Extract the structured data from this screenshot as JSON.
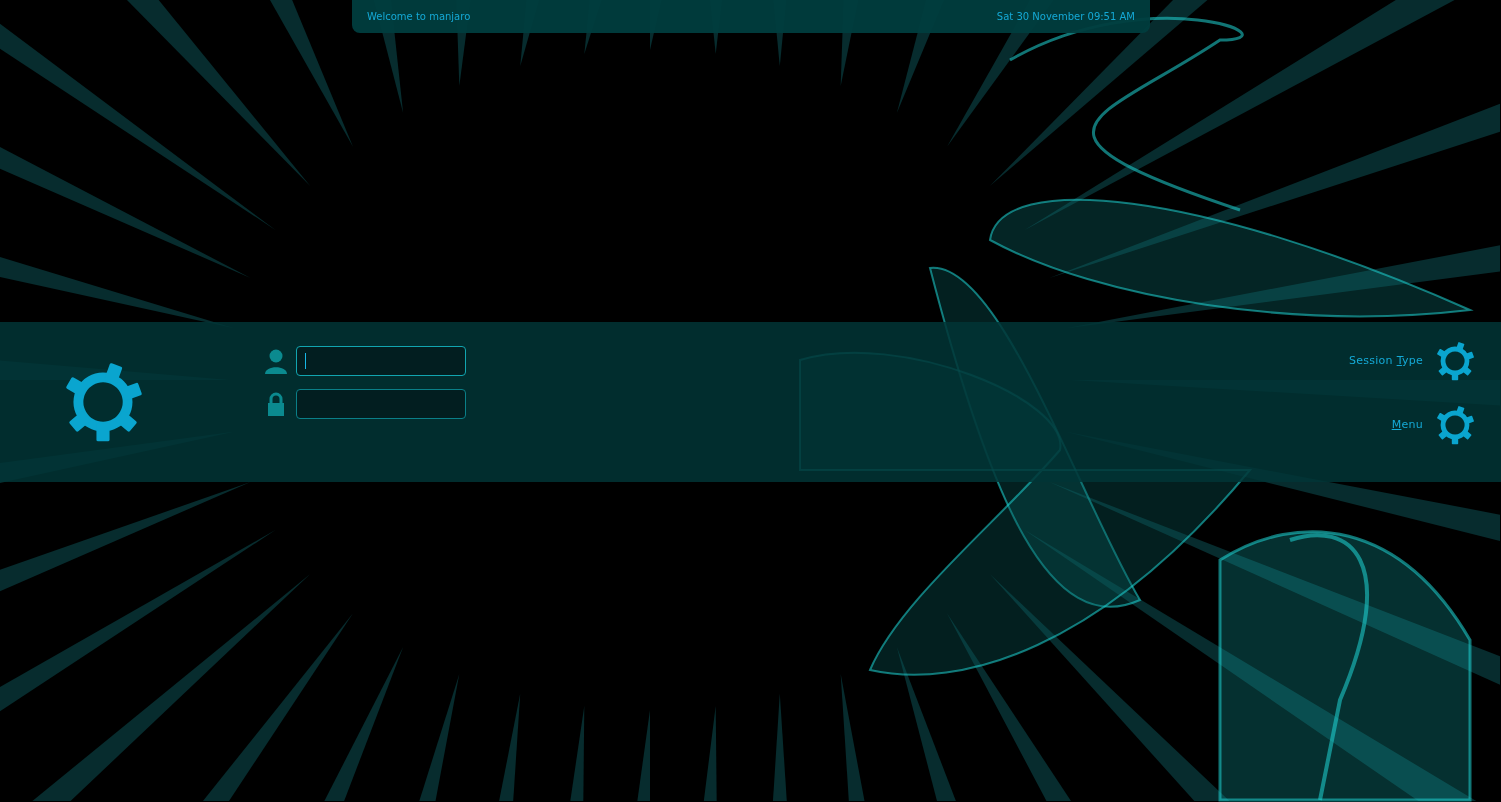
{
  "top_bar": {
    "welcome": "Welcome to manjaro",
    "clock": "Sat 30 November 09:51 AM"
  },
  "login": {
    "fields": [
      {
        "kind": "user",
        "focused": true
      },
      {
        "kind": "password",
        "focused": false
      }
    ]
  },
  "actions": [
    {
      "before": "Session ",
      "mnemonic": "T",
      "after": "ype"
    },
    {
      "mnemonic": "M",
      "after": "enu"
    }
  ]
}
